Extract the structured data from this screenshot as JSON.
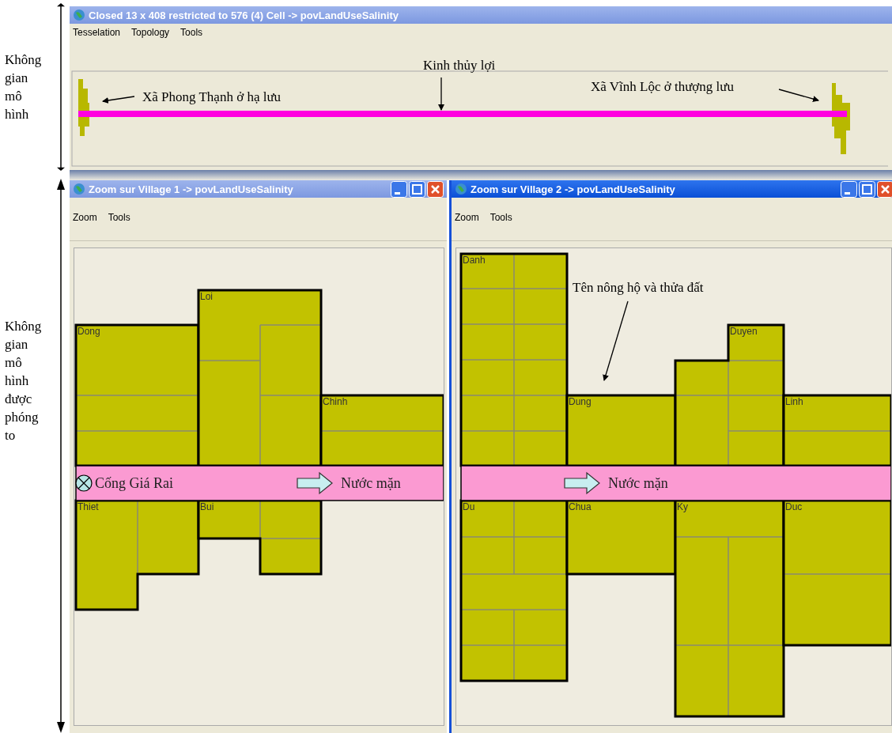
{
  "annotations_left": [
    {
      "text": "Không gian mô hình"
    },
    {
      "text": "Không gian mô hình được phóng to"
    }
  ],
  "main_window": {
    "title": "Closed 13 x 408 restricted to 576 (4) Cell -> povLandUseSalinity",
    "active": false,
    "menu": [
      "Tesselation",
      "Topology",
      "Tools"
    ],
    "labels": [
      {
        "text": "Xã Phong Thạnh ở hạ lưu"
      },
      {
        "text": "Kinh thủy lợi"
      },
      {
        "text": "Xã Vĩnh Lộc ở thượng lưu"
      }
    ]
  },
  "zoom_windows": [
    {
      "title": "Zoom sur Village 1 -> povLandUseSalinity",
      "active": false,
      "menu": [
        "Zoom",
        "Tools"
      ],
      "farms": [
        {
          "name": "Dong"
        },
        {
          "name": "Loi"
        },
        {
          "name": "Chinh"
        },
        {
          "name": "Thiet"
        },
        {
          "name": "Bui"
        }
      ],
      "band": {
        "gate": "Cống Giá Rai",
        "flow": "Nước mặn"
      }
    },
    {
      "title": "Zoom sur Village 2 -> povLandUseSalinity",
      "active": true,
      "menu": [
        "Zoom",
        "Tools"
      ],
      "farms": [
        {
          "name": "Danh"
        },
        {
          "name": "Dung"
        },
        {
          "name": "Duyen"
        },
        {
          "name": "Linh"
        },
        {
          "name": "Du"
        },
        {
          "name": "Chua"
        },
        {
          "name": "Ky"
        },
        {
          "name": "Duc"
        }
      ],
      "band": {
        "flow": "Nước mặn"
      },
      "note": "Tên nông hộ và thửa đất"
    }
  ]
}
